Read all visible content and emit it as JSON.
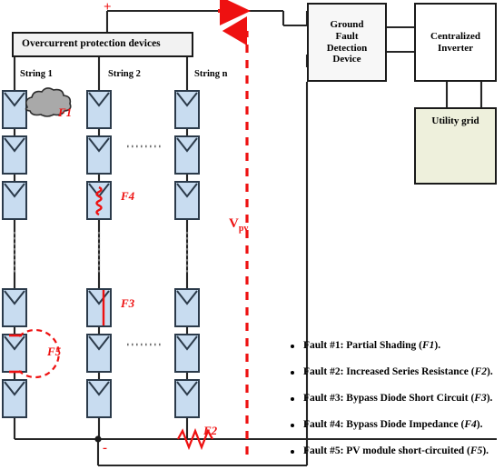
{
  "title": "PV array fault diagram",
  "polarity": {
    "positive": "+",
    "negative": "-"
  },
  "measurement": {
    "label": "V",
    "subscript": "pv"
  },
  "blocks": {
    "overcurrent": "Overcurrent protection devices",
    "ground_fault": [
      "Ground",
      "Fault",
      "Detection",
      "Device"
    ],
    "inverter": [
      "Centralized",
      "Inverter"
    ],
    "utility": "Utility grid"
  },
  "strings": [
    {
      "label": "String 1",
      "modules": 6
    },
    {
      "label": "String 2",
      "modules": 6
    },
    {
      "label": "String n",
      "modules": 6
    }
  ],
  "fault_tags": [
    {
      "id": "F1",
      "text": "F1"
    },
    {
      "id": "F2",
      "text": "F2"
    },
    {
      "id": "F3",
      "text": "F3"
    },
    {
      "id": "F4",
      "text": "F4"
    },
    {
      "id": "F5",
      "text": "F5"
    }
  ],
  "legend": [
    {
      "prefix": "Fault #1: Partial Shading (",
      "code": "F1",
      "suffix": ")."
    },
    {
      "prefix": "Fault #2: Increased Series Resistance (",
      "code": "F2",
      "suffix": ")."
    },
    {
      "prefix": "Fault #3: Bypass Diode Short Circuit (",
      "code": "F3",
      "suffix": ")."
    },
    {
      "prefix": "Fault #4: Bypass Diode Impedance (",
      "code": "F4",
      "suffix": ")."
    },
    {
      "prefix": "Fault #5: PV module short-circuited (",
      "code": "F5",
      "suffix": ")."
    }
  ],
  "colors": {
    "module_fill": "#c8dcf0",
    "module_stroke": "#2b3a4a",
    "wire": "#262626",
    "fault_red": "#ee1111",
    "grid_fill": "#eef0dc",
    "sine_blue": "#2b77b8",
    "cloud_fill": "#a9a9a9"
  }
}
